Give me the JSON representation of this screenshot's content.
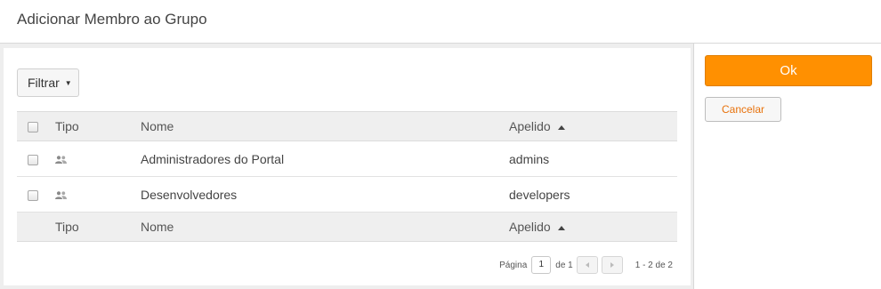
{
  "dialog": {
    "title": "Adicionar Membro ao Grupo"
  },
  "toolbar": {
    "filter_label": "Filtrar",
    "filter_icon": "caret-down-icon"
  },
  "table": {
    "columns": {
      "type": "Tipo",
      "name": "Nome",
      "alias": "Apelido"
    },
    "sort": {
      "column": "alias",
      "direction": "ascending"
    },
    "rows": [
      {
        "type_icon": "group-icon",
        "name": "Administradores do Portal",
        "alias": "admins"
      },
      {
        "type_icon": "group-icon",
        "name": "Desenvolvedores",
        "alias": "developers"
      }
    ],
    "footer": {
      "type": "Tipo",
      "name": "Nome",
      "alias": "Apelido"
    }
  },
  "pagination": {
    "page_label": "Página",
    "current_page": "1",
    "of_label": "de 1",
    "range": "1 - 2 de 2"
  },
  "actions": {
    "ok_label": "Ok",
    "cancel_label": "Cancelar"
  },
  "colors": {
    "accent": "#ff9001",
    "cancel_text": "#e8720c"
  }
}
